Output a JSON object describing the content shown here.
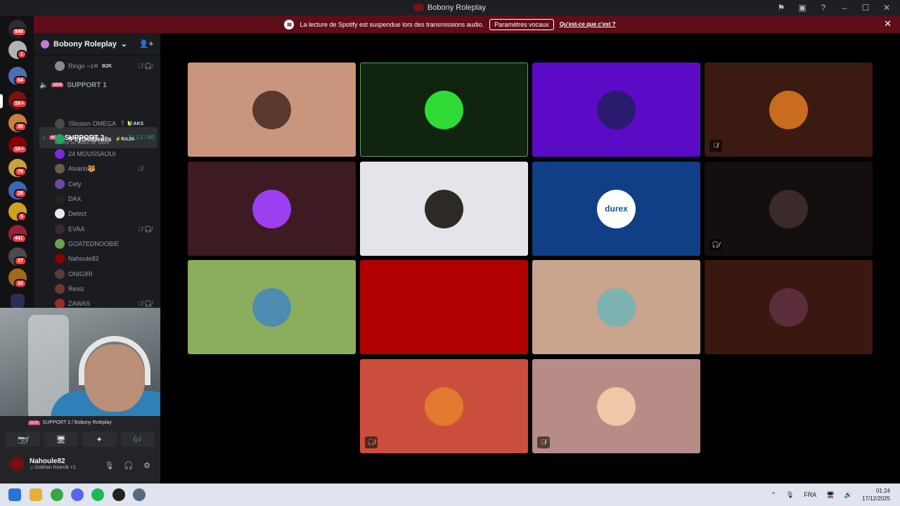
{
  "window": {
    "title": "Bobony Roleplay"
  },
  "titlebar_icons": [
    "inbox-icon",
    "screen-icon",
    "help-icon",
    "minimize-icon",
    "maximize-icon",
    "close-icon"
  ],
  "banner": {
    "message": "La lecture de Spotify est suspendue lors des transmissions audio.",
    "button": "Paramètres vocaux",
    "link": "Qu'est-ce que c'est ?",
    "close": "✕"
  },
  "rail": {
    "home_badge": "949",
    "badges": [
      "1",
      "64",
      "1K+",
      "35",
      "1K+",
      "79",
      "28",
      "5",
      "441",
      "37",
      "10"
    ]
  },
  "server": {
    "name": "Bobony Roleplay",
    "invite": "👤+"
  },
  "channels": {
    "support1": "SUPPORT 1",
    "support2": "SUPPORT 2",
    "timer": "3:11:00",
    "status_hint": "Définir un statut de salon",
    "badge": "SOS"
  },
  "voice_users_top": {
    "name": "Ringo ─ɪ✕",
    "tag": "B2K",
    "mute": "🎙̸ 🎧̸"
  },
  "voice_users": [
    {
      "name": "!Slosion OMEGA",
      "tag": "❓ 🔰AKS",
      "mute": ""
    },
    {
      "name": "!PsychoSkulls",
      "tag": "⚡RAJA",
      "mute": ""
    },
    {
      "name": "24 MOUSSAOUI",
      "tag": "",
      "mute": ""
    },
    {
      "name": "Alvario🐯",
      "tag": "",
      "mute": "🎙̸"
    },
    {
      "name": "Cety",
      "tag": "",
      "mute": ""
    },
    {
      "name": "DAX",
      "tag": "",
      "mute": ""
    },
    {
      "name": "Detect",
      "tag": "",
      "mute": ""
    },
    {
      "name": "EVAA",
      "tag": "",
      "mute": "🎙̸ 🎧̸"
    },
    {
      "name": "GOATEDNOOBIE",
      "tag": "",
      "mute": ""
    },
    {
      "name": "Nahoule82",
      "tag": "",
      "mute": ""
    },
    {
      "name": "ONIGIRI",
      "tag": "",
      "mute": ""
    },
    {
      "name": "Reviz",
      "tag": "",
      "mute": ""
    },
    {
      "name": "ZAWAS",
      "tag": "",
      "mute": "🎙̸ 🎧̸"
    }
  ],
  "user_panel": {
    "voice_location": "SUPPORT 2 / Bobony Roleplay",
    "buttons": [
      "📷̸",
      "🖥",
      "✦",
      "🎶"
    ],
    "username": "Nahoule82",
    "status": "♫ Gokhan Kivircik +1",
    "mic": "🎙",
    "headset": "🎧",
    "settings": "⚙"
  },
  "tiles": [
    {
      "bg": "#c9957c",
      "avatar": "#5a3a2e",
      "icon": ""
    },
    {
      "bg": "#11240f",
      "avatar": "#2edc35",
      "icon": "",
      "speaking": true
    },
    {
      "bg": "#5b0bc5",
      "avatar": "#2b1b6e",
      "icon": ""
    },
    {
      "bg": "#3b1a12",
      "avatar": "#c96c1e",
      "icon": "🎙̸"
    },
    {
      "bg": "#3e1a22",
      "avatar": "#9b3ff0",
      "icon": ""
    },
    {
      "bg": "#e3e5ea",
      "avatar": "#2d2a26",
      "icon": ""
    },
    {
      "bg": "#103f85",
      "avatar": "durex",
      "icon": ""
    },
    {
      "bg": "#150e0e",
      "avatar": "#3a2a2a",
      "icon": "🎧̸"
    },
    {
      "bg": "#8aae5e",
      "avatar": "#4f8bb0",
      "icon": ""
    },
    {
      "bg": "#b00000",
      "avatar": "#b00000",
      "icon": ""
    },
    {
      "bg": "#c9a48e",
      "avatar": "#7cb3b0",
      "icon": ""
    },
    {
      "bg": "#3a170f",
      "avatar": "#5b2d3a",
      "icon": ""
    },
    {
      "bg": "#cc4e3d",
      "avatar": "#e1792e",
      "icon": "🎧̸"
    },
    {
      "bg": "#b88c86",
      "avatar": "#f0c8a8",
      "icon": "🎙̸"
    }
  ],
  "durex_label": "durex",
  "taskbar": {
    "lang": "FRA",
    "time": "01:24",
    "date": "17/12/2025"
  }
}
